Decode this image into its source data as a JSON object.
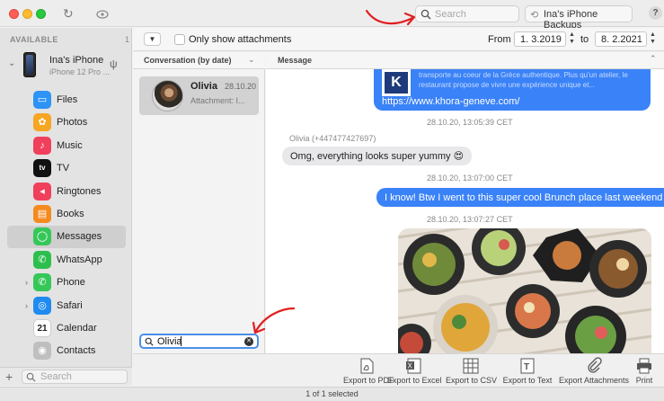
{
  "titlebar": {
    "search_placeholder": "Search",
    "backups_label": "Ina's iPhone Backups",
    "help_label": "?"
  },
  "sidebar": {
    "section_label": "AVAILABLE",
    "section_count": "1",
    "device_name": "Ina's iPhone",
    "device_model": "iPhone 12 Pro ...",
    "items": [
      {
        "label": "Files",
        "icon": "folder-icon",
        "color": "#2d93f5",
        "glyph": "▭"
      },
      {
        "label": "Photos",
        "icon": "photos-icon",
        "color": "#f6a623",
        "glyph": "✿"
      },
      {
        "label": "Music",
        "icon": "music-icon",
        "color": "#f0405b",
        "glyph": "♪"
      },
      {
        "label": "TV",
        "icon": "tv-icon",
        "color": "#111111",
        "glyph": "tv"
      },
      {
        "label": "Ringtones",
        "icon": "ringtones-icon",
        "color": "#f0405b",
        "glyph": "◂"
      },
      {
        "label": "Books",
        "icon": "books-icon",
        "color": "#f58a1f",
        "glyph": "▤"
      },
      {
        "label": "Messages",
        "icon": "messages-icon",
        "color": "#36c759",
        "glyph": "◯"
      },
      {
        "label": "WhatsApp",
        "icon": "whatsapp-icon",
        "color": "#2dbf4e",
        "glyph": "✆"
      },
      {
        "label": "Phone",
        "icon": "phone-icon",
        "color": "#36c759",
        "glyph": "✆"
      },
      {
        "label": "Safari",
        "icon": "safari-icon",
        "color": "#1f8bf0",
        "glyph": "◎"
      },
      {
        "label": "Calendar",
        "icon": "calendar-icon",
        "color": "#ffffff",
        "glyph": "21"
      },
      {
        "label": "Contacts",
        "icon": "contacts-icon",
        "color": "#bfbfbf",
        "glyph": "◉"
      }
    ],
    "search_placeholder": "Search"
  },
  "toolbar": {
    "only_attachments_label": "Only show attachments",
    "from_label": "From",
    "from_date": "1. 3.2019",
    "to_label": "to",
    "to_date": "8. 2.2021"
  },
  "conversations": {
    "header": "Conversation (by date)",
    "items": [
      {
        "name": "Olivia",
        "date": "28.10.20",
        "preview": "Attachment: I..."
      }
    ],
    "search_value": "Olivia"
  },
  "messages": {
    "header": "Message",
    "card_desc": "transporte au coeur de la Grèce authentique. Plus qu'un atelier, le restaurant propose de vivre une expérience unique et...",
    "card_url": "https://www.khora-geneve.com/",
    "ts1": "28.10.20, 13:05:39 CET",
    "sender": "Olivia (+447477427697)",
    "msg1": "Omg, everything looks super yummy 😍",
    "ts2": "28.10.20, 13:07:00 CET",
    "msg2": "I know! Btw I went to this super cool Brunch place last weekend 🥞",
    "ts3": "28.10.20, 13:07:27 CET"
  },
  "export": [
    {
      "label": "Export to PDF",
      "icon": "pdf-icon"
    },
    {
      "label": "Export to Excel",
      "icon": "excel-icon"
    },
    {
      "label": "Export to CSV",
      "icon": "csv-icon"
    },
    {
      "label": "Export to Text",
      "icon": "text-icon"
    },
    {
      "label": "Export Attachments",
      "icon": "paperclip-icon"
    },
    {
      "label": "Print",
      "icon": "printer-icon"
    }
  ],
  "status": "1 of 1 selected",
  "colors": {
    "accent": "#3a82f7",
    "annotation": "#e02020"
  }
}
